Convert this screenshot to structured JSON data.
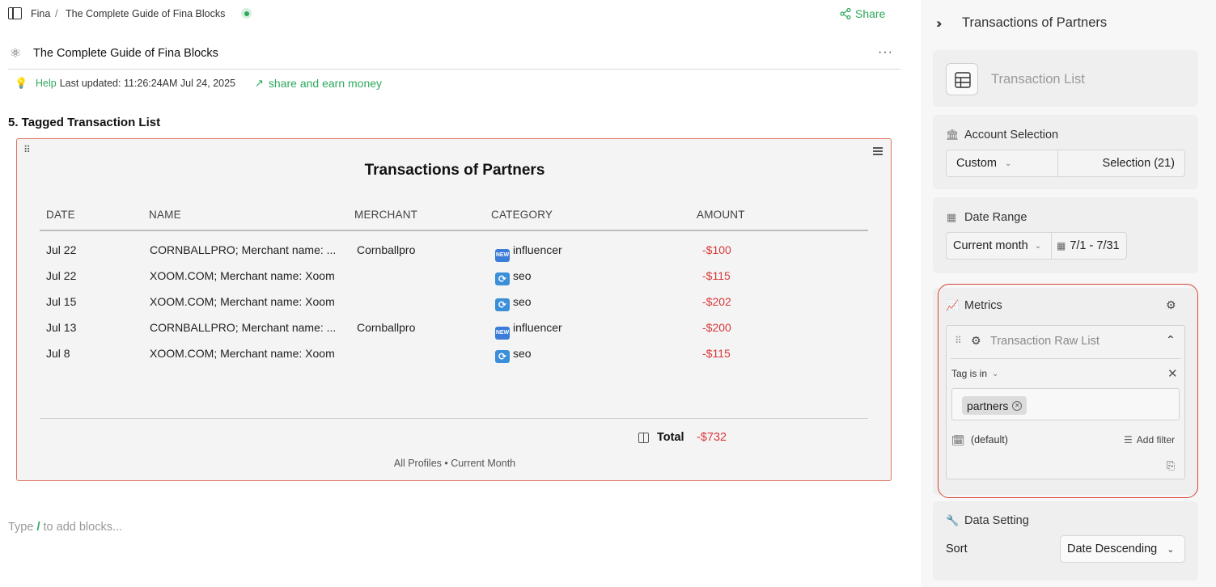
{
  "breadcrumb": {
    "root": "Fina",
    "separator": "/",
    "page": "The Complete Guide of Fina Blocks"
  },
  "share_label": "Share",
  "doc": {
    "title": "The Complete Guide of Fina Blocks",
    "more_label": "···",
    "help_label": "Help",
    "last_updated": "Last updated: 11:26:24AM Jul 24, 2025",
    "earn_label": "share and earn money"
  },
  "section_title": "5. Tagged Transaction List",
  "block": {
    "title": "Transactions of Partners",
    "columns": [
      "DATE",
      "NAME",
      "MERCHANT",
      "CATEGORY",
      "AMOUNT"
    ],
    "rows": [
      {
        "date": "Jul 22",
        "name": "CORNBALLPRO; Merchant name: ...",
        "merchant": "Cornballpro",
        "category": "influencer",
        "badge": "NEW",
        "amount": "-$100"
      },
      {
        "date": "Jul 22",
        "name": "XOOM.COM; Merchant name: Xoom",
        "merchant": "",
        "category": "seo",
        "badge": "⟳",
        "amount": "-$115"
      },
      {
        "date": "Jul 15",
        "name": "XOOM.COM; Merchant name: Xoom",
        "merchant": "",
        "category": "seo",
        "badge": "⟳",
        "amount": "-$202"
      },
      {
        "date": "Jul 13",
        "name": "CORNBALLPRO; Merchant name: ...",
        "merchant": "Cornballpro",
        "category": "influencer",
        "badge": "NEW",
        "amount": "-$200"
      },
      {
        "date": "Jul 8",
        "name": "XOOM.COM; Merchant name: Xoom",
        "merchant": "",
        "category": "seo",
        "badge": "⟳",
        "amount": "-$115"
      }
    ],
    "total_label": "Total",
    "total_value": "-$732",
    "footer": "All Profiles • Current Month"
  },
  "type_hint": {
    "before": "Type ",
    "slash": "/",
    "after": " to add blocks..."
  },
  "panel": {
    "title": "Transactions of Partners",
    "block_type": "Transaction List",
    "account": {
      "heading": "Account Selection",
      "mode": "Custom",
      "selection": "Selection (21)"
    },
    "date": {
      "heading": "Date Range",
      "preset": "Current month",
      "range": "7/1 - 7/31"
    },
    "metrics": {
      "heading": "Metrics",
      "item": "Transaction Raw List",
      "filter_label": "Tag is in",
      "tag": "partners",
      "default_label": "(default)",
      "add_filter": "Add filter"
    },
    "data_setting": {
      "heading": "Data Setting",
      "sort_label": "Sort",
      "sort_value": "Date Descending"
    }
  },
  "colors": {
    "accent": "#2ea85c",
    "negative": "#d9383a",
    "highlight": "#d9463a"
  }
}
